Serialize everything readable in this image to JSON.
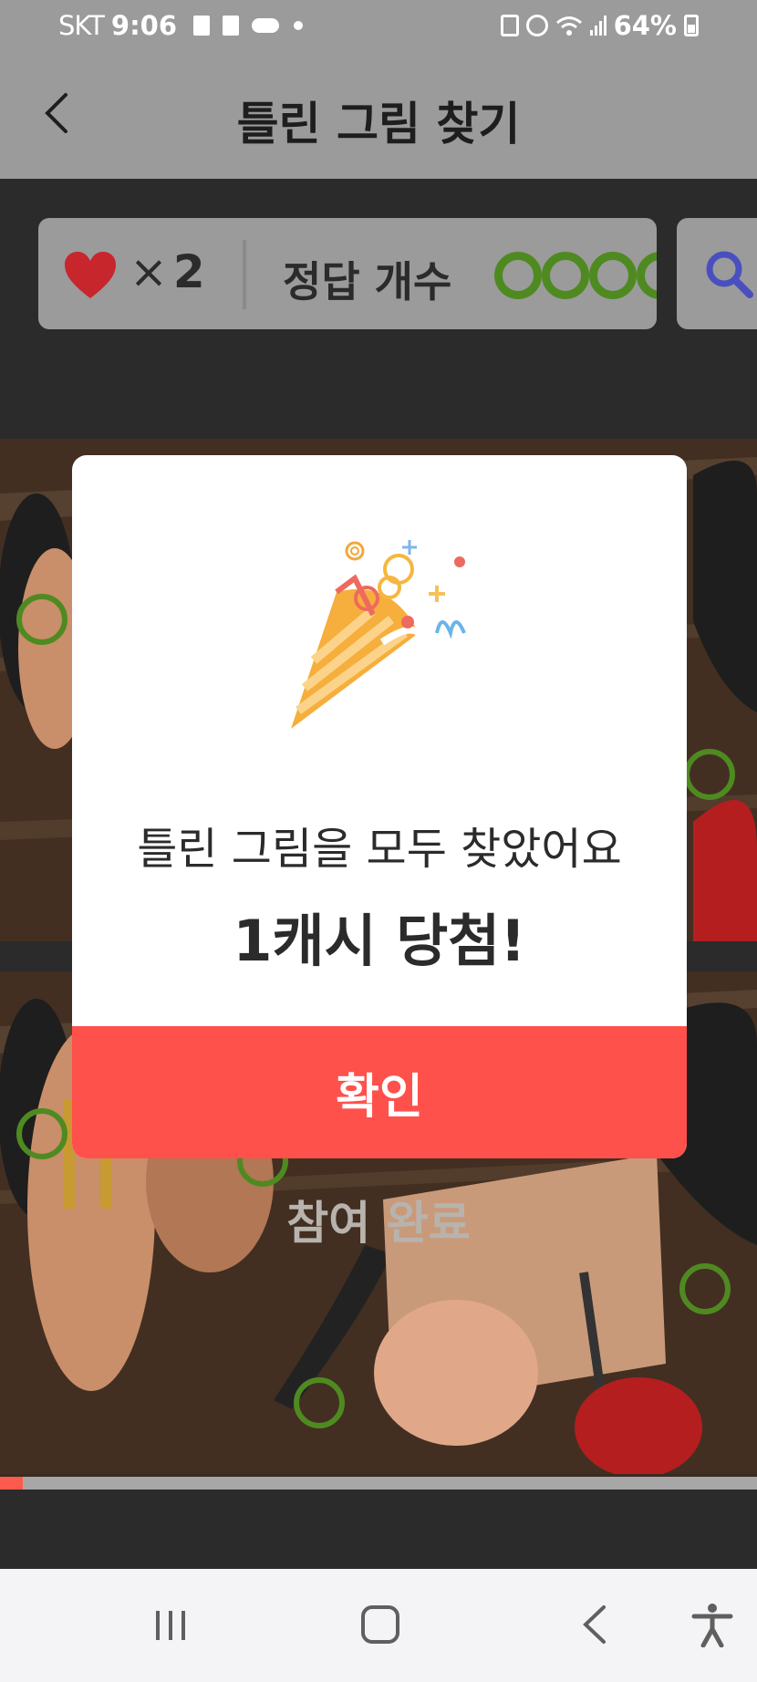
{
  "status_bar": {
    "carrier": "SKT",
    "time": "9:06",
    "battery": "64%"
  },
  "header": {
    "title": "틀린 그림 찾기",
    "back_icon": "chevron-left-icon"
  },
  "stats": {
    "lives_symbol": "×",
    "lives_count": "2",
    "answers_label": "정답 개수",
    "answers_found": 4,
    "heart_icon": "heart-icon",
    "hint_icon": "search-icon"
  },
  "game": {
    "status_text": "참여 완료",
    "progress": 0.03
  },
  "modal": {
    "icon": "party-popper-icon",
    "message": "틀린 그림을 모두 찾았어요",
    "reward": "1캐시 당첨!",
    "confirm_label": "확인"
  },
  "nav": {
    "recents_icon": "recents-icon",
    "home_icon": "home-icon",
    "back_icon": "back-icon",
    "accessibility_icon": "accessibility-icon"
  },
  "colors": {
    "accent": "#ff514c",
    "found_circle": "#4f8a21",
    "heart": "#c8262d",
    "search": "#4a4fc0"
  }
}
